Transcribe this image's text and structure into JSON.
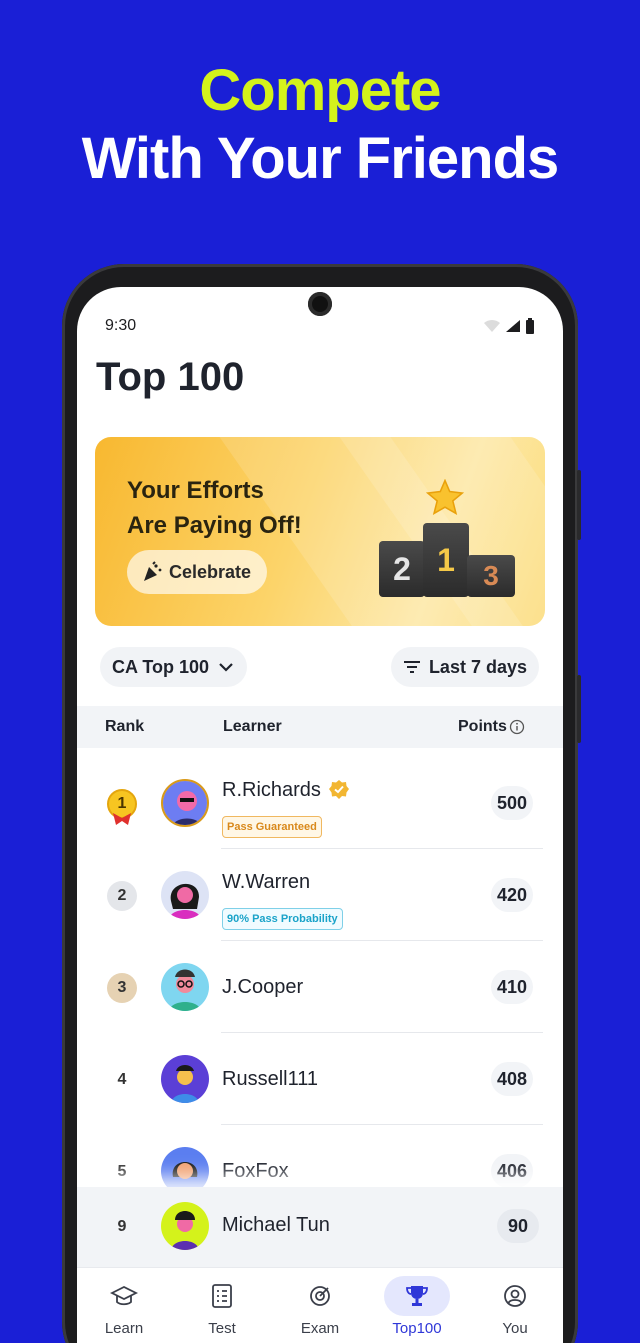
{
  "promo": {
    "line1": "Compete",
    "line2": "With Your Friends"
  },
  "status": {
    "time": "9:30"
  },
  "page_title": "Top 100",
  "banner": {
    "line1": "Your Efforts",
    "line2": "Are Paying Off!",
    "celebrate_label": "Celebrate",
    "podium": [
      "2",
      "1",
      "3"
    ]
  },
  "filters": {
    "board": "CA Top 100",
    "period": "Last 7 days"
  },
  "table": {
    "headers": {
      "rank": "Rank",
      "learner": "Learner",
      "points": "Points"
    },
    "rows": [
      {
        "rank": "1",
        "name": "R.Richards",
        "tag": "Pass Guaranteed",
        "points": "500"
      },
      {
        "rank": "2",
        "name": "W.Warren",
        "tag": "90% Pass Probability",
        "points": "420"
      },
      {
        "rank": "3",
        "name": "J.Cooper",
        "tag": "",
        "points": "410"
      },
      {
        "rank": "4",
        "name": "Russell111",
        "tag": "",
        "points": "408"
      },
      {
        "rank": "5",
        "name": "FoxFox",
        "tag": "",
        "points": "406"
      }
    ],
    "me": {
      "rank": "9",
      "name": "Michael Tun",
      "points": "90"
    }
  },
  "nav": {
    "items": [
      "Learn",
      "Test",
      "Exam",
      "Top100",
      "You"
    ],
    "active": "Top100"
  },
  "colors": {
    "background": "#1a1fd6",
    "accent_green": "#d4f21b",
    "active_nav": "#2f37d8"
  }
}
